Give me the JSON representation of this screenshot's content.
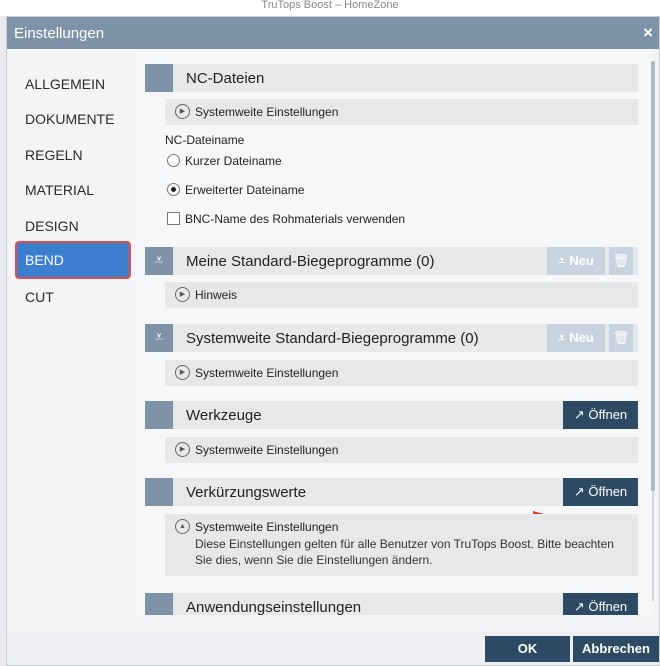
{
  "background_window_title": "TruTops Boost – HomeZone",
  "dialog": {
    "title": "Einstellungen",
    "close_glyph": "×"
  },
  "nav": {
    "items": [
      {
        "label": "ALLGEMEIN"
      },
      {
        "label": "DOKUMENTE"
      },
      {
        "label": "REGELN"
      },
      {
        "label": "MATERIAL"
      },
      {
        "label": "DESIGN"
      },
      {
        "label": "BEND",
        "active": true
      },
      {
        "label": "CUT"
      }
    ]
  },
  "nc": {
    "title": "NC-Dateien",
    "sub": "Systemweite Einstellungen",
    "filename_label": "NC-Dateiname",
    "radio_short": "Kurzer Dateiname",
    "radio_extended": "Erweiterter Dateiname",
    "radio_selected": "extended",
    "checkbox_label": "BNC-Name des Rohmaterials verwenden",
    "checkbox_checked": false
  },
  "my_programs": {
    "title": "Meine Standard-Biegeprogramme (0)",
    "new_label": "Neu",
    "sub": "Hinweis"
  },
  "sys_programs": {
    "title": "Systemweite Standard-Biegeprogramme (0)",
    "new_label": "Neu",
    "sub": "Systemweite Einstellungen"
  },
  "tools": {
    "title": "Werkzeuge",
    "open_label": "Öffnen",
    "sub": "Systemweite Einstellungen"
  },
  "shortening": {
    "title": "Verkürzungswerte",
    "open_label": "Öffnen",
    "sub": "Systemweite Einstellungen",
    "note": "Diese Einstellungen gelten für alle Benutzer von TruTops Boost. Bitte beachten Sie dies, wenn Sie die Einstellungen ändern."
  },
  "app_settings": {
    "title": "Anwendungseinstellungen",
    "open_label": "Öffnen"
  },
  "footer": {
    "ok": "OK",
    "cancel": "Abbrechen"
  },
  "icons": {
    "bend": "bend-program-icon",
    "trash": "trash-icon",
    "open": "open-external-icon",
    "expand": "expand-circle-icon",
    "collapse": "collapse-circle-icon"
  },
  "colors": {
    "titlebar": "#7f93a8",
    "nav_active": "#3c7fd1",
    "highlight": "#e0504e",
    "button_dark": "#2c4a64",
    "button_disabled": "#c7d3df"
  }
}
